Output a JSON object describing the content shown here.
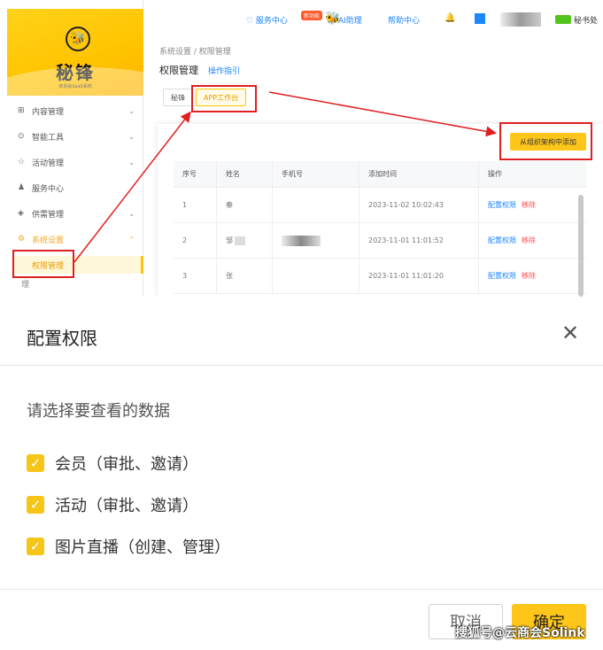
{
  "brand": {
    "name": "秘锋",
    "sub": "商协会SaaS系统"
  },
  "sidebar": {
    "items": [
      {
        "label": "内容管理",
        "icon": "grid-icon",
        "glyph": "⊞",
        "chev": "⌄"
      },
      {
        "label": "智能工具",
        "icon": "tool-icon",
        "glyph": "⊙",
        "chev": "⌄"
      },
      {
        "label": "活动管理",
        "icon": "star-icon",
        "glyph": "☆",
        "chev": "⌄"
      },
      {
        "label": "服务中心",
        "icon": "people-icon",
        "glyph": "♟",
        "chev": ""
      },
      {
        "label": "供需管理",
        "icon": "shield-icon",
        "glyph": "◈",
        "chev": "⌄"
      },
      {
        "label": "系统设置",
        "icon": "gear-icon",
        "glyph": "⚙",
        "chev": "⌃"
      }
    ],
    "active_sub": "权限管理",
    "next_sub": "理"
  },
  "header": {
    "service": "♡ 服务中心",
    "new_badge": "新功能",
    "ai": "AI助理",
    "help": "帮助中心",
    "user": "秘书处"
  },
  "content": {
    "breadcrumb": "系统设置 / 权限管理",
    "title": "权限管理",
    "guide": "操作指引",
    "tabs": [
      "秘锋",
      "APP工作台"
    ],
    "add_button": "从组织架构中添加",
    "table": {
      "columns": [
        "序号",
        "姓名",
        "手机号",
        "添加时间",
        "操作"
      ],
      "rows": [
        {
          "no": "1",
          "name": "秦",
          "time": "2023-11-02 10:02:43"
        },
        {
          "no": "2",
          "name": "邹",
          "time": "2023-11-01 11:01:52"
        },
        {
          "no": "3",
          "name": "张",
          "time": "2023-11-01 11:01:20"
        }
      ],
      "action_config": "配置权限",
      "action_remove": "移除"
    }
  },
  "modal": {
    "title": "配置权限",
    "close": "✕",
    "subtitle": "请选择要查看的数据",
    "options": [
      {
        "label": "会员（审批、邀请）",
        "checked": true
      },
      {
        "label": "活动（审批、邀请）",
        "checked": true
      },
      {
        "label": "图片直播（创建、管理）",
        "checked": true
      }
    ],
    "check_mark": "✓",
    "cancel": "取消",
    "ok": "确定"
  },
  "watermark": "搜狐号@云商会Solink",
  "colors": {
    "accent": "#ffc61a",
    "link": "#1e86ff",
    "danger": "#ff4d4f",
    "annotation": "#e02020"
  }
}
